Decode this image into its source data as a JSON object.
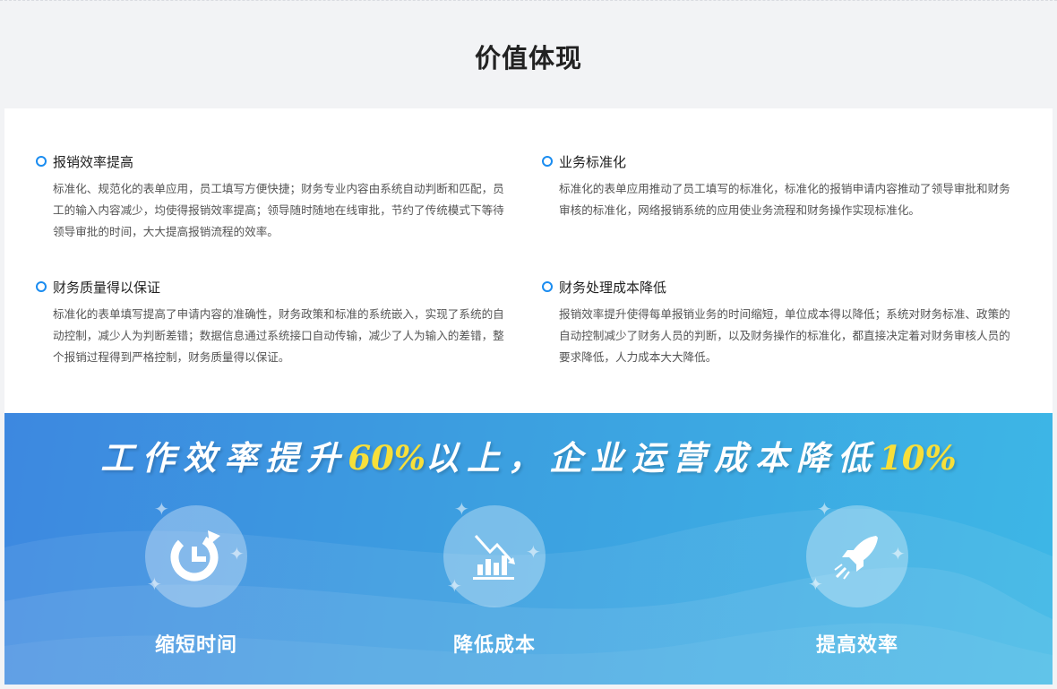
{
  "section_title": "价值体现",
  "items": [
    {
      "title": "报销效率提高",
      "body": "标准化、规范化的表单应用，员工填写方便快捷；财务专业内容由系统自动判断和匹配，员工的输入内容减少，均使得报销效率提高；领导随时随地在线审批，节约了传统模式下等待领导审批的时间，大大提高报销流程的效率。"
    },
    {
      "title": "业务标准化",
      "body": "标准化的表单应用推动了员工填写的标准化，标准化的报销申请内容推动了领导审批和财务审核的标准化，网络报销系统的应用使业务流程和财务操作实现标准化。"
    },
    {
      "title": "财务质量得以保证",
      "body": "标准化的表单填写提高了申请内容的准确性，财务政策和标准的系统嵌入，实现了系统的自动控制，减少人为判断差错；数据信息通过系统接口自动传输，减少了人为输入的差错，整个报销过程得到严格控制，财务质量得以保证。"
    },
    {
      "title": "财务处理成本降低",
      "body": "报销效率提升使得每单报销业务的时间缩短，单位成本得以降低；系统对财务标准、政策的自动控制减少了财务人员的判断，以及财务操作的标准化，都直接决定着对财务审核人员的要求降低，人力成本大大降低。"
    }
  ],
  "banner": {
    "slogan_part1": "工作效率提升",
    "slogan_hl1": "60%",
    "slogan_part2": "以上，企业运营成本降低",
    "slogan_hl2": "10%",
    "features": [
      {
        "label": "缩短时间",
        "icon": "clock-refresh-icon"
      },
      {
        "label": "降低成本",
        "icon": "bar-chart-down-icon"
      },
      {
        "label": "提高效率",
        "icon": "rocket-icon"
      }
    ]
  },
  "colors": {
    "accent": "#1a8cf0",
    "highlight": "#f7df3a",
    "banner_start": "#3d88e0",
    "banner_end": "#3db7e6"
  }
}
